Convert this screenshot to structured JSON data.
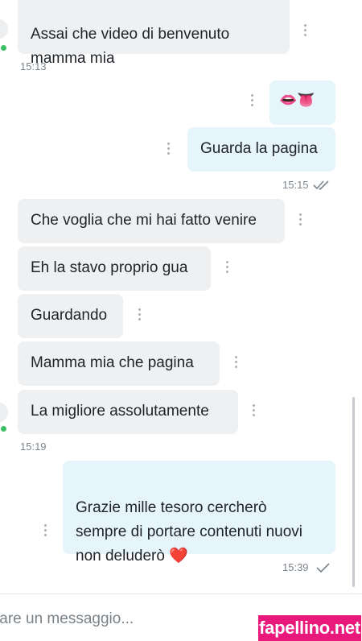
{
  "messages": [
    {
      "text": "Assai che video di benvenuto\nmamma mia"
    },
    {
      "text": "👄👅"
    },
    {
      "text": "Guarda la pagina"
    },
    {
      "text": "Che voglia che mi hai fatto venire"
    },
    {
      "text": "Eh la stavo proprio gua"
    },
    {
      "text": "Guardando"
    },
    {
      "text": "Mamma mia che pagina"
    },
    {
      "text": "La migliore assolutamente"
    },
    {
      "text": "Grazie mille tesoro cercherò\nsempre di portare contenuti nuovi\nnon deluderò ❤️"
    }
  ],
  "timestamps": {
    "t1": "15:13",
    "t2": "15:15",
    "t3": "15:19",
    "t4": "15:39"
  },
  "status": {
    "t2_icon": "double-check-icon",
    "t4_icon": "single-check-icon",
    "online_color": "#3bc063"
  },
  "composer": {
    "placeholder": "tare un messaggio..."
  },
  "watermark": {
    "text": "fapellino.net",
    "color": "#e8197a"
  },
  "colors": {
    "incoming_bubble": "#eef0f2",
    "outgoing_bubble": "#e6f4fc"
  }
}
